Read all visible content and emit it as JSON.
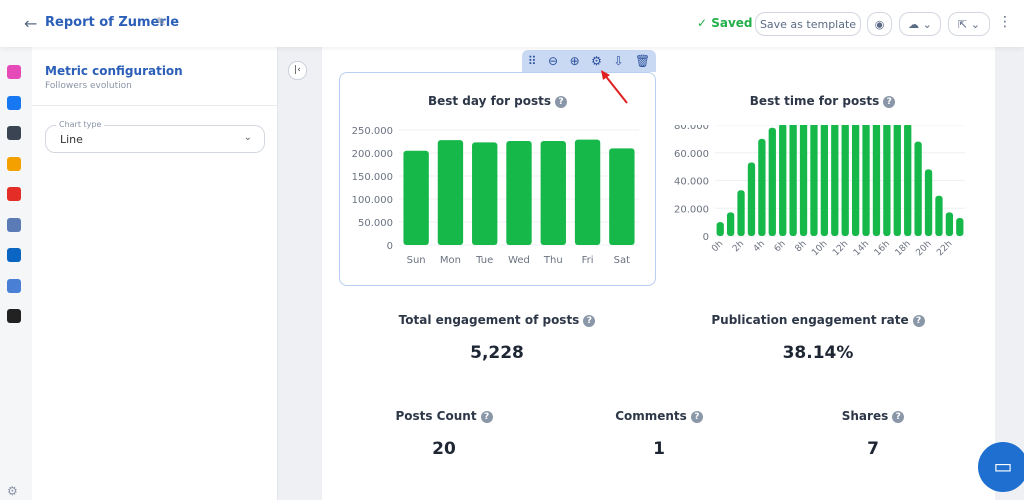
{
  "header": {
    "title": "Report of Zumerle",
    "saved": "Saved",
    "save_template": "Save as template"
  },
  "config": {
    "title": "Metric configuration",
    "subtitle": "Followers evolution",
    "chart_type_label": "Chart type",
    "chart_type_value": "Line"
  },
  "rail": [
    {
      "name": "instagram",
      "color": "#e64ab8"
    },
    {
      "name": "facebook",
      "color": "#1877f2"
    },
    {
      "name": "facebook-pages",
      "color": "#3b4452"
    },
    {
      "name": "google-analytics",
      "color": "#f4a100"
    },
    {
      "name": "youtube",
      "color": "#e52d27"
    },
    {
      "name": "google-ads",
      "color": "#5a7bb5"
    },
    {
      "name": "linkedin",
      "color": "#0a66c2"
    },
    {
      "name": "google-business",
      "color": "#4a7fd6"
    },
    {
      "name": "mailchimp",
      "color": "#222222"
    }
  ],
  "toolbar": [
    "drag-icon",
    "zoom-out-icon",
    "zoom-in-icon",
    "settings-icon",
    "download-icon",
    "trash-icon"
  ],
  "colors": {
    "bar": "#16b84a",
    "accent": "#2b5fb8"
  },
  "stats": [
    {
      "label": "Total engagement of posts",
      "value": "5,228"
    },
    {
      "label": "Publication engagement rate",
      "value": "38.14%"
    },
    {
      "label": "Posts Count",
      "value": "20"
    },
    {
      "label": "Comments",
      "value": "1"
    },
    {
      "label": "Shares",
      "value": "7"
    }
  ],
  "chart_data": [
    {
      "type": "bar",
      "title": "Best day for posts",
      "categories": [
        "Sun",
        "Mon",
        "Tue",
        "Wed",
        "Thu",
        "Fri",
        "Sat"
      ],
      "values": [
        205000,
        228000,
        223000,
        226000,
        226000,
        229000,
        210000
      ],
      "yticks": [
        "0",
        "50.000",
        "100.000",
        "150.000",
        "200.000",
        "250.000"
      ],
      "ylim": [
        0,
        250000
      ],
      "grid": true
    },
    {
      "type": "bar",
      "title": "Best time for posts",
      "categories": [
        "0h",
        "1h",
        "2h",
        "3h",
        "4h",
        "5h",
        "6h",
        "7h",
        "8h",
        "9h",
        "10h",
        "11h",
        "12h",
        "13h",
        "14h",
        "15h",
        "16h",
        "17h",
        "18h",
        "19h",
        "20h",
        "21h",
        "22h",
        "23h"
      ],
      "values": [
        10000,
        17000,
        33000,
        53000,
        70000,
        78000,
        81000,
        83000,
        86000,
        87000,
        84000,
        82000,
        83000,
        85000,
        87000,
        87000,
        86000,
        86000,
        81000,
        68000,
        48000,
        29000,
        17000,
        13000
      ],
      "yticks": [
        "0",
        "20.000",
        "40.000",
        "60.000",
        "80.000"
      ],
      "ylim": [
        0,
        80000
      ],
      "grid": true
    }
  ]
}
